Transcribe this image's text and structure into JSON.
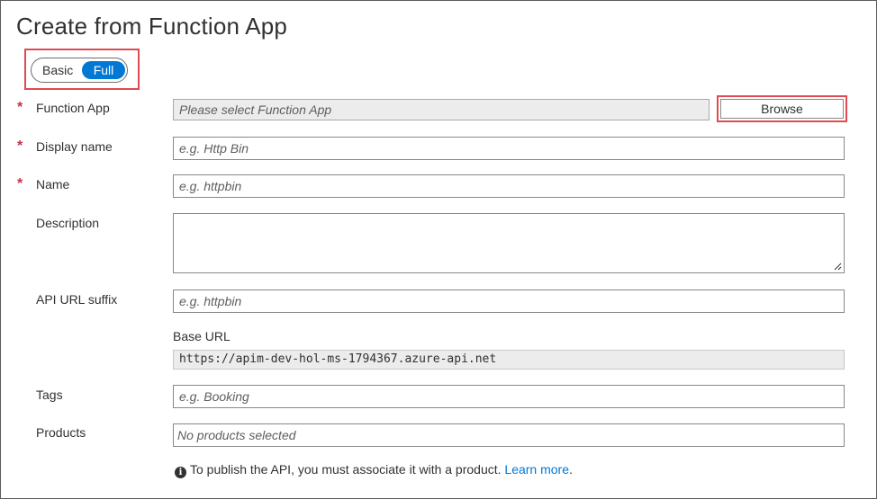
{
  "page": {
    "title": "Create from Function App"
  },
  "mode_toggle": {
    "basic_label": "Basic",
    "full_label": "Full",
    "selected": "Full"
  },
  "form": {
    "required_marker": "*",
    "function_app": {
      "label": "Function App",
      "placeholder": "Please select Function App",
      "browse_label": "Browse"
    },
    "display_name": {
      "label": "Display name",
      "placeholder": "e.g. Http Bin"
    },
    "name": {
      "label": "Name",
      "placeholder": "e.g. httpbin"
    },
    "description": {
      "label": "Description",
      "value": ""
    },
    "api_url_suffix": {
      "label": "API URL suffix",
      "placeholder": "e.g. httpbin"
    },
    "base_url": {
      "label": "Base URL",
      "value": "https://apim-dev-hol-ms-1794367.azure-api.net"
    },
    "tags": {
      "label": "Tags",
      "placeholder": "e.g. Booking"
    },
    "products": {
      "label": "Products",
      "placeholder": "No products selected"
    }
  },
  "notice": {
    "icon": "info-icon",
    "text": "To publish the API, you must associate it with a product.",
    "link_text": "Learn more",
    "trailing": "."
  },
  "colors": {
    "accent": "#0078d4",
    "required": "#c4314b",
    "highlight": "#e04a50"
  }
}
